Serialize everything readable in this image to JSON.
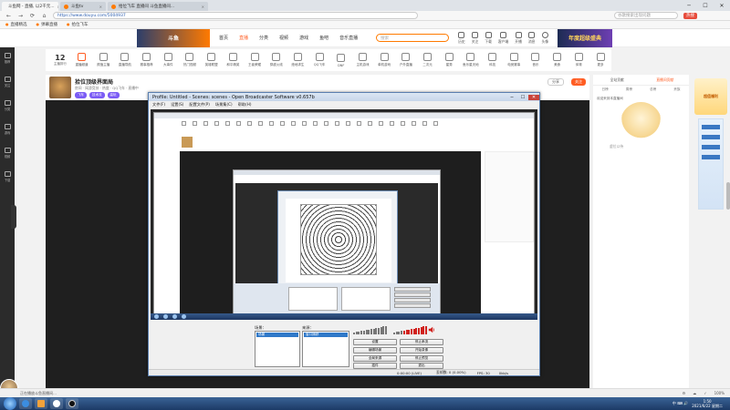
{
  "browser": {
    "tabs": [
      {
        "label": "斗鱼网 - 直播, 以2千元...",
        "active": true
      },
      {
        "label": "斗鱼tv",
        "active": false
      },
      {
        "label": "拾位飞车 直播间 斗鱼直播间...",
        "active": false
      }
    ],
    "url": "https://www.douyu.com/5004937",
    "search_placeholder": "谷歌搜索出现问题",
    "hot_button": "热搜",
    "favorites": [
      "直播精选",
      "弹幕直播",
      "拾位飞车"
    ],
    "window_controls": [
      "─",
      "☐",
      "✕"
    ],
    "nav": [
      "←",
      "→",
      "⟳",
      "⌂"
    ]
  },
  "site": {
    "logo": "斗鱼",
    "nav": [
      {
        "label": "首页",
        "on": false
      },
      {
        "label": "直播",
        "on": true
      },
      {
        "label": "分类",
        "on": false
      },
      {
        "label": "视频",
        "on": false
      },
      {
        "label": "游戏",
        "on": false
      },
      {
        "label": "鱼吧",
        "on": false
      },
      {
        "label": "音乐直播",
        "on": false
      }
    ],
    "search_placeholder": "搜索",
    "user_icons": [
      "历史",
      "关注",
      "下载",
      "客户端",
      "开播",
      "消息",
      "头像"
    ],
    "promo": "年度超级盛典"
  },
  "categories": {
    "date_number": "12",
    "date_label": "主播排行",
    "items": [
      "重播频道",
      "颜值主播",
      "直播导航",
      "赛事推荐",
      "大事件",
      "热门视频",
      "英雄联盟",
      "和平精英",
      "王者荣耀",
      "穿越火线",
      "绝地求生",
      "QQ飞车",
      "DNF",
      "主机游戏",
      "单机游戏",
      "户外直播",
      "二次元",
      "星秀",
      "鱼乐星天地",
      "科技",
      "电竞赛事",
      "音乐",
      "美食",
      "体育",
      "更多"
    ]
  },
  "left_sidebar": [
    "推荐",
    "关注",
    "分类",
    "游戏",
    "视频",
    "下载"
  ],
  "room": {
    "title": "拾位顶级界面局",
    "meta": "房间 · 网游竞技 · 热度 · QQ飞车 · 直播中",
    "tags": [
      "飞车",
      "技术流",
      "高玩"
    ],
    "follow": "关注",
    "share": "分享"
  },
  "obs": {
    "title": "Profile: Untitled - Scenes: scenes - Open Broadcaster Software v0.657b",
    "menu": [
      "文件(F)",
      "设置(S)",
      "配置文件(P)",
      "场景集(C)",
      "帮助(H)"
    ],
    "scenes_label": "场景：",
    "sources_label": "来源：",
    "scene_selected": "场景",
    "source_selected": "窗口捕获",
    "buttons": [
      "设置",
      "停止串流",
      "编辑场景",
      "开始录像",
      "全局来源",
      "停止预览",
      "插件",
      "退出"
    ],
    "status_time": "0:00:00 (LIVE)",
    "status_dropped": "丢帧数: 0 (0.00%)",
    "status_fps": "FPS: 30",
    "status_bitrate": "0kb/s"
  },
  "right_panel": {
    "tabs": [
      {
        "label": "全站贡献",
        "on": false
      },
      {
        "label": "直播间贡献",
        "on": true
      }
    ],
    "subtabs": [
      "日榜",
      "周榜",
      "总榜",
      "贵族"
    ],
    "notice": "欢迎来到本直播间",
    "empty_text": "虚位以待"
  },
  "far_right": {
    "ad": "超值福利"
  },
  "statusbar": {
    "left": "正在播放斗鱼直播间…",
    "zoom": "100%",
    "items": [
      "⚙",
      "☁",
      "✓"
    ]
  },
  "taskbar": {
    "apps": [
      "#3c8de0",
      "#f2a23b",
      "#ffffff",
      "#111111"
    ],
    "tray": "中  ⌨  🔊",
    "time": "1:50",
    "date": "2021/6/22 星期二"
  }
}
